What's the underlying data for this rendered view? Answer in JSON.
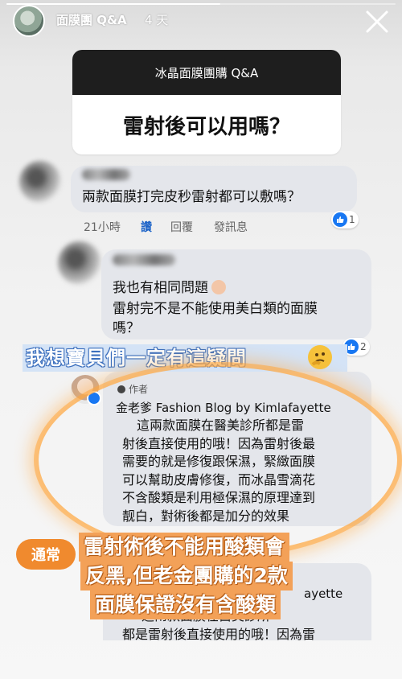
{
  "story": {
    "username": "面膜團 Q&A",
    "time": "4 天",
    "progress": 0.55
  },
  "qa": {
    "title": "冰晶面膜團購 Q&A",
    "question": "雷射後可以用嗎？"
  },
  "comment1": {
    "text": "兩款面膜打完皮秒雷射都可以敷嗎？",
    "time": "21小時",
    "read": "讚",
    "reply": "回覆",
    "send": "發訊息",
    "likes": "1"
  },
  "comment2": {
    "line1": "我也有相同問題",
    "line2": "雷射完不是不能使用美白類的面膜",
    "line3": "嗎？",
    "likes": "2"
  },
  "sticker_blue": "我想寶貝們一定有這疑問",
  "author": {
    "tag": "作者",
    "name": "金老爹 Fashion Blog by Kimlafayette",
    "lines": [
      "這兩款面膜在醫美診所都是雷",
      "射後直接使用的哦！因為雷射後最",
      "需要的就是修復跟保濕，緊緻面膜",
      "可以幫助皮膚修復，而冰晶雪滴花",
      "不含酸類是利用極保濕的原理達到",
      "靓白，對術後都是加分的效果"
    ]
  },
  "author2": {
    "name_tail": "ayette",
    "line1": "這兩款面膜在醫美診所",
    "line2": "都是雷射後直接使用的哦！因為雷"
  },
  "stickers_orange": {
    "pill": "通常",
    "line1": "雷射術後不能用酸類會",
    "line2": "反黑,但老金團購的2款",
    "line3": "面膜保證沒有含酸類"
  },
  "colors": {
    "accent_blue": "#1877f2",
    "orange": "#f08a2e",
    "bubble": "#e4e6eb"
  }
}
